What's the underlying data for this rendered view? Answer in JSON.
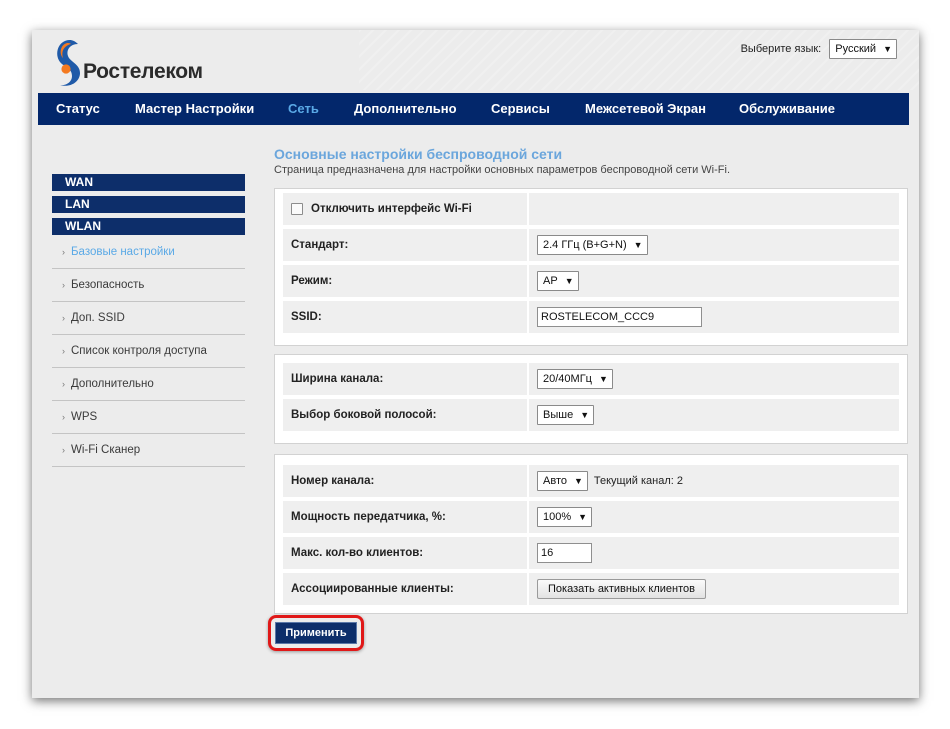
{
  "brand": {
    "name": "Ростелеком",
    "logo_colors": {
      "orange": "#f47a20",
      "blue": "#1f5aa8"
    }
  },
  "language": {
    "label": "Выберите язык:",
    "selected": "Русский"
  },
  "nav": {
    "items": [
      {
        "label": "Статус",
        "active": false
      },
      {
        "label": "Мастер Настройки",
        "active": false
      },
      {
        "label": "Сеть",
        "active": true
      },
      {
        "label": "Дополнительно",
        "active": false
      },
      {
        "label": "Сервисы",
        "active": false
      },
      {
        "label": "Межсетевой Экран",
        "active": false
      },
      {
        "label": "Обслуживание",
        "active": false
      }
    ]
  },
  "sidebar": {
    "sections": [
      {
        "label": "WAN"
      },
      {
        "label": "LAN"
      },
      {
        "label": "WLAN"
      }
    ],
    "subitems": [
      {
        "label": "Базовые настройки",
        "active": true
      },
      {
        "label": "Безопасность",
        "active": false
      },
      {
        "label": "Доп. SSID",
        "active": false
      },
      {
        "label": "Список контроля доступа",
        "active": false
      },
      {
        "label": "Дополнительно",
        "active": false
      },
      {
        "label": "WPS",
        "active": false
      },
      {
        "label": "Wi-Fi Сканер",
        "active": false
      }
    ]
  },
  "page": {
    "title": "Основные настройки беспроводной сети",
    "description": "Страница предназначена для настройки основных параметров беспроводной сети Wi-Fi."
  },
  "panel1": {
    "disable_wifi_label": "Отключить интерфейс Wi-Fi",
    "disable_wifi_checked": false,
    "standard_label": "Стандарт:",
    "standard_value": "2.4 ГГц (B+G+N)",
    "mode_label": "Режим:",
    "mode_value": "AP",
    "ssid_label": "SSID:",
    "ssid_value": "ROSTELECOM_CCC9"
  },
  "panel2": {
    "channel_width_label": "Ширина канала:",
    "channel_width_value": "20/40МГц",
    "sideband_label": "Выбор боковой полосой:",
    "sideband_value": "Выше"
  },
  "panel3": {
    "channel_label": "Номер канала:",
    "channel_value": "Авто",
    "current_channel_text": "Текущий канал: 2",
    "power_label": "Мощность передатчика, %:",
    "power_value": "100%",
    "max_clients_label": "Макс. кол-во клиентов:",
    "max_clients_value": "16",
    "assoc_label": "Ассоциированные клиенты:",
    "show_clients_button": "Показать активных клиентов"
  },
  "actions": {
    "apply": "Применить",
    "highlight_color": "#e01818"
  }
}
